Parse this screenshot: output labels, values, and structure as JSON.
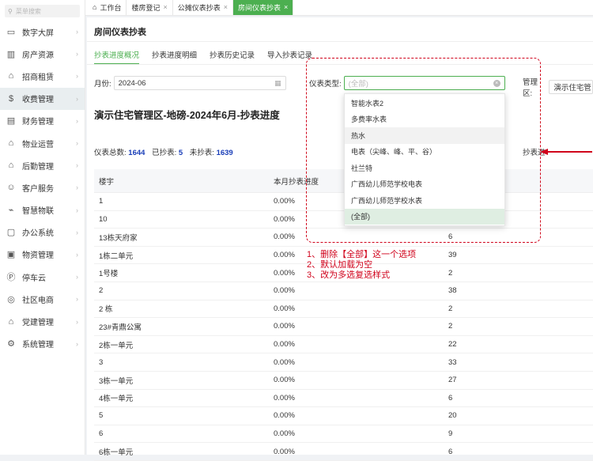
{
  "sidebar": {
    "search_placeholder": "菜单搜索",
    "items": [
      {
        "label": "数字大屏",
        "icon": "monitor-icon",
        "active": false
      },
      {
        "label": "房产资源",
        "icon": "building-icon",
        "active": false
      },
      {
        "label": "招商租赁",
        "icon": "house-icon",
        "active": false
      },
      {
        "label": "收费管理",
        "icon": "money-bag-icon",
        "active": true
      },
      {
        "label": "财务管理",
        "icon": "ledger-icon",
        "active": false
      },
      {
        "label": "物业运营",
        "icon": "operations-icon",
        "active": false
      },
      {
        "label": "后勤管理",
        "icon": "logistics-icon",
        "active": false
      },
      {
        "label": "客户服务",
        "icon": "customer-icon",
        "active": false
      },
      {
        "label": "智慧物联",
        "icon": "iot-icon",
        "active": false
      },
      {
        "label": "办公系统",
        "icon": "briefcase-icon",
        "active": false
      },
      {
        "label": "物资管理",
        "icon": "box-icon",
        "active": false
      },
      {
        "label": "停车云",
        "icon": "parking-icon",
        "active": false
      },
      {
        "label": "社区电商",
        "icon": "shop-icon",
        "active": false
      },
      {
        "label": "党建管理",
        "icon": "party-icon",
        "active": false
      },
      {
        "label": "系统管理",
        "icon": "gear-icon",
        "active": false
      }
    ]
  },
  "tabs": [
    {
      "label": "工作台",
      "closable": false,
      "active": false
    },
    {
      "label": "楼房登记",
      "closable": true,
      "active": false
    },
    {
      "label": "公摊仪表抄表",
      "closable": true,
      "active": false
    },
    {
      "label": "房间仪表抄表",
      "closable": true,
      "active": true
    }
  ],
  "page": {
    "title": "房间仪表抄表",
    "subtabs": [
      "抄表进度概况",
      "抄表进度明细",
      "抄表历史记录",
      "导入抄表记录"
    ],
    "filters": {
      "month_label": "月份:",
      "month_value": "2024-06",
      "meter_type_label": "仪表类型:",
      "meter_type_placeholder": "(全部)",
      "management_label": "管理区:",
      "management_value": "演示住宅管"
    },
    "report_title": "演示住宅管理区-地磅-2024年6月-抄表进度",
    "stats": {
      "total_label": "仪表总数:",
      "total": "1644",
      "read_label": "已抄表:",
      "read": "5",
      "unread_label": "未抄表:",
      "unread": "1639"
    },
    "progress_header_partial": "抄表进"
  },
  "table": {
    "headers": [
      "楼宇",
      "本月抄表进度",
      ""
    ],
    "rows": [
      [
        "1",
        "0.00%",
        ""
      ],
      [
        "10",
        "0.00%",
        ""
      ],
      [
        "13栋天府家",
        "0.00%",
        "6"
      ],
      [
        "1栋二单元",
        "0.00%",
        "39"
      ],
      [
        "1号楼",
        "0.00%",
        "2"
      ],
      [
        "2",
        "0.00%",
        "38"
      ],
      [
        "2 栋",
        "0.00%",
        "2"
      ],
      [
        "23#青鼎公寓",
        "0.00%",
        "2"
      ],
      [
        "2栋一单元",
        "0.00%",
        "22"
      ],
      [
        "3",
        "0.00%",
        "33"
      ],
      [
        "3栋一单元",
        "0.00%",
        "27"
      ],
      [
        "4栋一单元",
        "0.00%",
        "6"
      ],
      [
        "5",
        "0.00%",
        "20"
      ],
      [
        "6",
        "0.00%",
        "9"
      ],
      [
        "6栋一单元",
        "0.00%",
        "6"
      ]
    ]
  },
  "dropdown": {
    "options": [
      "智能水表2",
      "多费率水表",
      "热水",
      "电表（尖峰、峰、平、谷）",
      "社兰特",
      "广西幼儿师范学校电表",
      "广西幼儿师范学校水表",
      "(全部)"
    ],
    "hover_index": 2,
    "selected_index": 7
  },
  "annotation": {
    "color": "#d0021b",
    "lines": [
      "1、删除【全部】这一个选项",
      "2、默认加载为空",
      "3、改为多选复选样式"
    ]
  },
  "colors": {
    "accent": "#4caf50",
    "stat_number": "#1a3eb8"
  }
}
